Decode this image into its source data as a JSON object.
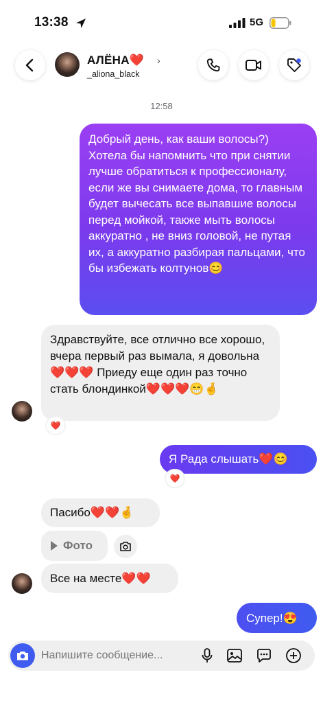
{
  "status_bar": {
    "time": "13:38",
    "network": "5G"
  },
  "header": {
    "name": "АЛЁНА❤️",
    "username": "_aliona_black"
  },
  "chat": {
    "timestamp": "12:58",
    "msg1": "Добрый день, как ваши волосы?) Хотела бы напомнить что при снятии лучше обратиться к профессионалу, если же вы снимаете дома, то главным будет вычесать все выпавшие волосы перед мойкой, также мыть волосы аккуратно , не вниз головой, не путая их, а аккуратно разбирая пальцами, что бы избежать колтунов😊",
    "msg2": "Здравствуйте, все отлично все хорошо, вчера первый раз вымала, я довольна❤️❤️❤️ Приеду еще один раз точно стать блондинкой❤️❤️❤️😁🤞",
    "msg2_reaction": "❤️",
    "msg3": "Я Рада слышать❤️😊",
    "msg3_reaction": "❤️",
    "msg4": "Пасибо❤️❤️🤞",
    "photo_label": "Фото",
    "msg5": "Все на месте❤️❤️",
    "msg6": "Супер!😍"
  },
  "composer": {
    "placeholder": "Напишите сообщение..."
  },
  "icons": {
    "back": "chevron-left-icon",
    "call": "phone-icon",
    "video": "video-camera-icon",
    "tag": "tag-icon",
    "camera": "camera-icon",
    "mic": "microphone-icon",
    "gallery": "image-icon",
    "sticker": "chat-bubble-icon",
    "add": "plus-circle-icon"
  },
  "colors": {
    "accent_purple": "#7c3aed",
    "accent_blue": "#3f5bf0",
    "incoming_bg": "#efefef"
  }
}
